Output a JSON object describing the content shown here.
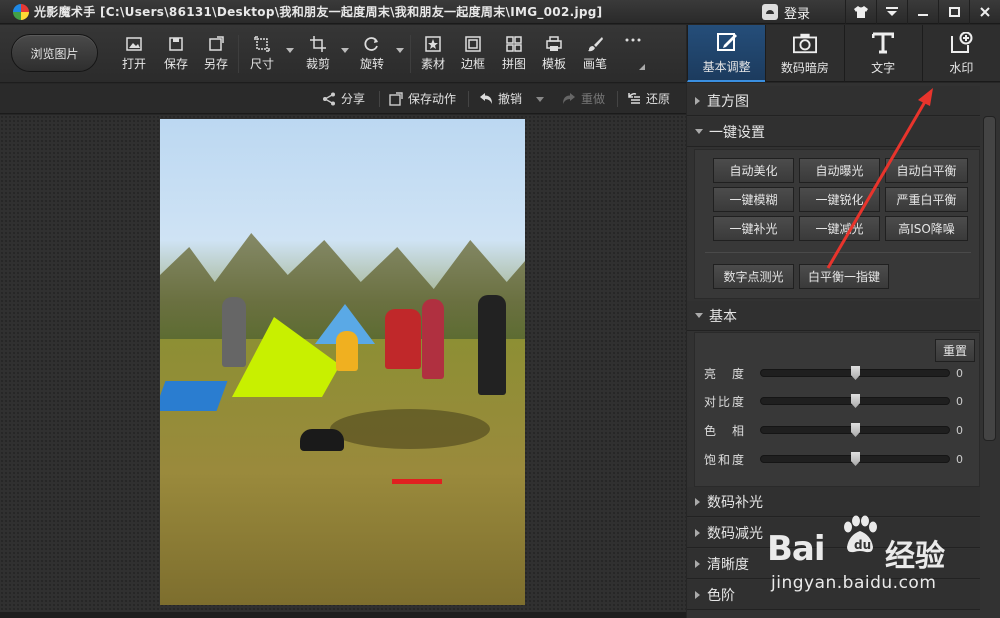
{
  "window": {
    "title": "光影魔术手 [C:\\Users\\86131\\Desktop\\我和朋友一起度周末\\我和朋友一起度周末\\IMG_002.jpg]",
    "login_label": "登录",
    "controls": [
      "shirt-icon",
      "dropdown-icon",
      "minimize-icon",
      "maximize-icon",
      "close-icon"
    ]
  },
  "toolbar": {
    "browse_label": "浏览图片",
    "tools": [
      {
        "label": "打开",
        "icon": "open-icon"
      },
      {
        "label": "保存",
        "icon": "save-icon"
      },
      {
        "label": "另存",
        "icon": "save-as-icon"
      },
      {
        "label": "尺寸",
        "icon": "resize-icon"
      },
      {
        "label": "裁剪",
        "icon": "crop-icon"
      },
      {
        "label": "旋转",
        "icon": "rotate-icon"
      },
      {
        "label": "素材",
        "icon": "material-icon"
      },
      {
        "label": "边框",
        "icon": "border-icon"
      },
      {
        "label": "拼图",
        "icon": "collage-icon"
      },
      {
        "label": "模板",
        "icon": "print-icon"
      },
      {
        "label": "画笔",
        "icon": "brush-icon"
      },
      {
        "label": "",
        "icon": "more-icon"
      }
    ]
  },
  "right_tabs": [
    {
      "label": "基本调整",
      "icon": "adjust-icon",
      "active": true
    },
    {
      "label": "数码暗房",
      "icon": "camera-icon",
      "active": false
    },
    {
      "label": "文字",
      "icon": "text-icon",
      "active": false
    },
    {
      "label": "水印",
      "icon": "watermark-icon",
      "active": false
    }
  ],
  "actions": {
    "share": "分享",
    "save_action": "保存动作",
    "undo": "撤销",
    "redo": "重做",
    "restore": "还原"
  },
  "panel": {
    "histogram": "直方图",
    "one_click": "一键设置",
    "one_click_buttons": [
      [
        "自动美化",
        "自动曝光",
        "自动白平衡"
      ],
      [
        "一键模糊",
        "一键锐化",
        "严重白平衡"
      ],
      [
        "一键补光",
        "一键减光",
        "高ISO降噪"
      ]
    ],
    "extra_buttons": [
      "数字点测光",
      "白平衡一指键"
    ],
    "basic": "基本",
    "reset": "重置",
    "sliders": [
      {
        "label": "亮　度",
        "value": "0",
        "fraction": 0.5
      },
      {
        "label": "对比度",
        "value": "0",
        "fraction": 0.5
      },
      {
        "label": "色　相",
        "value": "0",
        "fraction": 0.5
      },
      {
        "label": "饱和度",
        "value": "0",
        "fraction": 0.5
      }
    ],
    "more_sections": [
      "数码补光",
      "数码减光",
      "清晰度",
      "色阶"
    ]
  },
  "watermark": {
    "brand": "Bai",
    "brand2": "du",
    "cn": "经验",
    "url": "jingyan.baidu.com"
  },
  "colors": {
    "accent_tab": "#1c3b5e",
    "annotation_arrow": "#e8342c"
  }
}
